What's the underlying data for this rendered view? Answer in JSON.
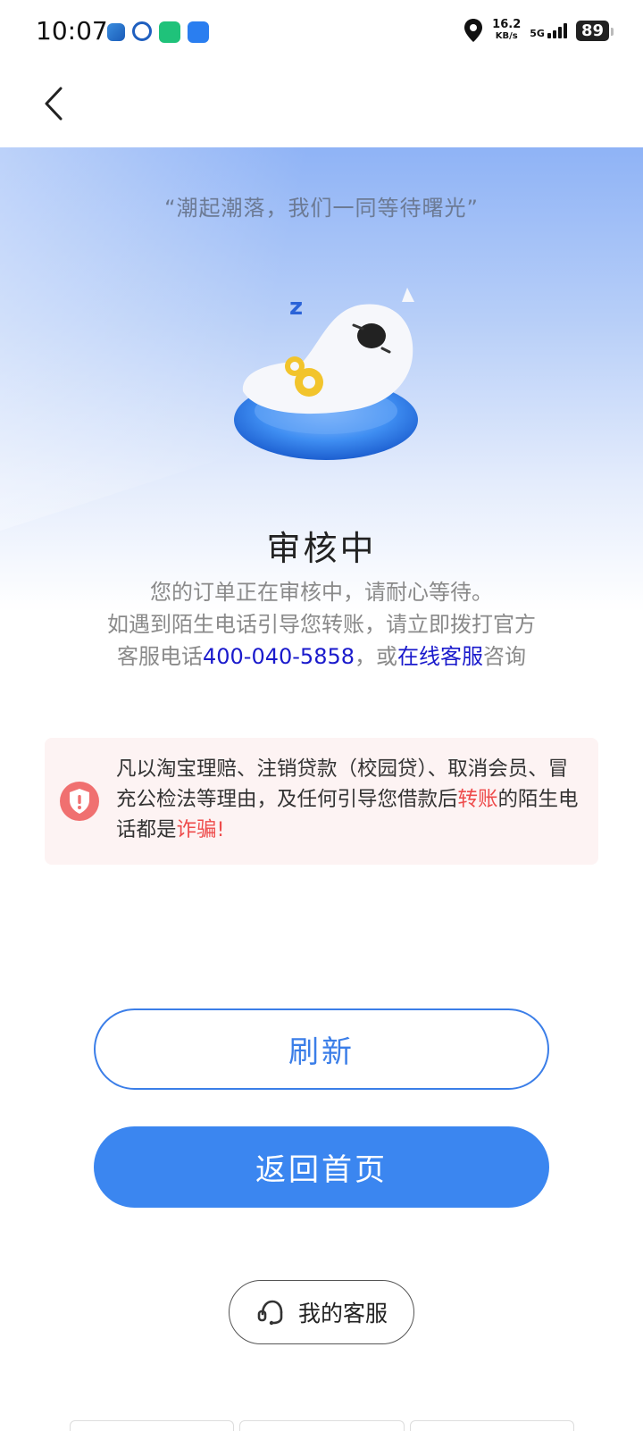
{
  "status_bar": {
    "time": "10:07",
    "net_speed_value": "16.2",
    "net_speed_unit": "KB/s",
    "network_type": "5G",
    "battery": "89"
  },
  "hero": {
    "quote": "“潮起潮落，我们一同等待曙光”",
    "status_title": "审核中"
  },
  "description": {
    "line1": "您的订单正在审核中，请耐心等待。",
    "line2": "如遇到陌生电话引导您转账，请立即拨打官方",
    "line3_prefix": "客服电话",
    "phone": "400-040-5858",
    "line3_middle": "，或",
    "online_service": "在线客服",
    "line3_suffix": "咨询"
  },
  "warning": {
    "text_part1": "凡以淘宝理赔、注销贷款（校园贷）、取消会员、冒充公检法等理由，及任何引导您借款后",
    "highlight_transfer": "转账",
    "text_part2": "的陌生电话都是",
    "highlight_fraud": "诈骗!"
  },
  "buttons": {
    "refresh": "刷新",
    "home": "返回首页",
    "service": "我的客服"
  },
  "colors": {
    "primary": "#3b86f0",
    "link": "#1a1acc",
    "danger": "#ee4b4b"
  }
}
